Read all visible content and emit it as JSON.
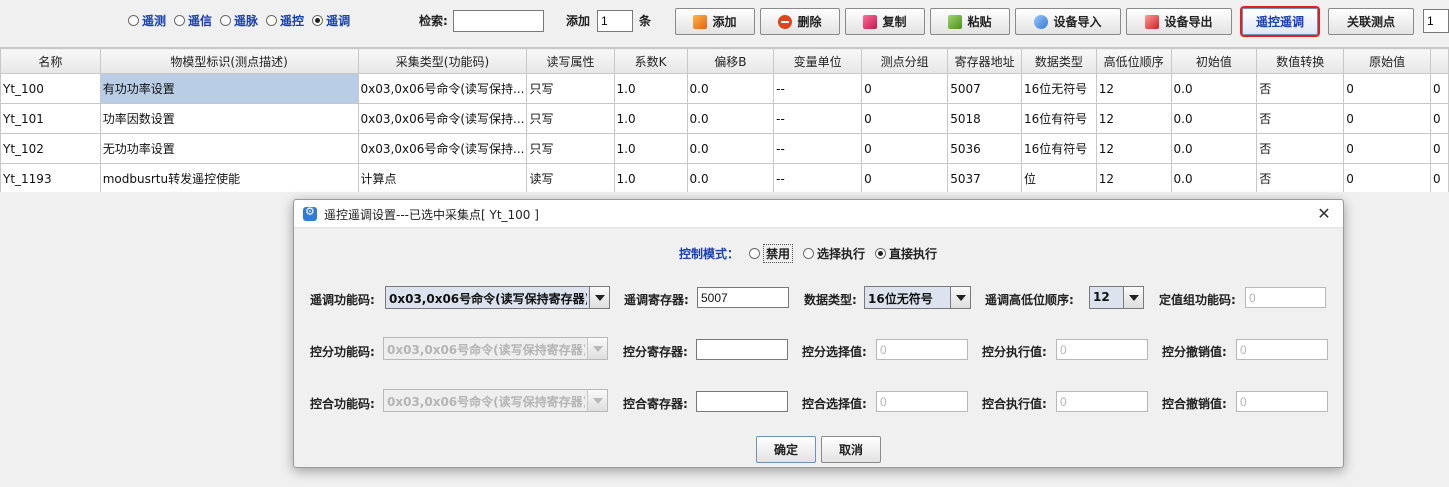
{
  "toolbar": {
    "radios": [
      {
        "label": "遥测",
        "selected": false
      },
      {
        "label": "遥信",
        "selected": false
      },
      {
        "label": "遥脉",
        "selected": false
      },
      {
        "label": "遥控",
        "selected": false
      },
      {
        "label": "遥调",
        "selected": true
      }
    ],
    "search_label": "检索:",
    "search_value": "",
    "add_label": "添加",
    "add_count": "1",
    "add_unit": "条",
    "buttons": {
      "add": "添加",
      "delete": "删除",
      "copy": "复制",
      "paste": "粘贴",
      "import": "设备导入",
      "export": "设备导出",
      "remote_control": "遥控遥调",
      "related_points": "关联测点"
    },
    "trailing_value": "1"
  },
  "table": {
    "columns": [
      "名称",
      "物模型标识(测点描述)",
      "采集类型(功能码)",
      "读写属性",
      "系数K",
      "偏移B",
      "变量单位",
      "测点分组",
      "寄存器地址",
      "数据类型",
      "高低位顺序",
      "初始值",
      "数值转换",
      "原始值",
      ""
    ],
    "rows": [
      {
        "cells": [
          "Yt_100",
          "有功功率设置",
          "0x03,0x06号命令(读写保持...",
          "只写",
          "1.0",
          "0.0",
          "--",
          "0",
          "5007",
          "16位无符号",
          "12",
          "0.0",
          "否",
          "0",
          "0"
        ],
        "selected": true
      },
      {
        "cells": [
          "Yt_101",
          "功率因数设置",
          "0x03,0x06号命令(读写保持...",
          "只写",
          "1.0",
          "0.0",
          "--",
          "0",
          "5018",
          "16位有符号",
          "12",
          "0.0",
          "否",
          "0",
          "0"
        ],
        "selected": false
      },
      {
        "cells": [
          "Yt_102",
          "无功功率设置",
          "0x03,0x06号命令(读写保持...",
          "只写",
          "1.0",
          "0.0",
          "--",
          "0",
          "5036",
          "16位有符号",
          "12",
          "0.0",
          "否",
          "0",
          "0"
        ],
        "selected": false
      },
      {
        "cells": [
          "Yt_1193",
          "modbusrtu转发遥控使能",
          "计算点",
          "读写",
          "1.0",
          "0.0",
          "--",
          "0",
          "5037",
          "位",
          "12",
          "0.0",
          "否",
          "0",
          "0"
        ],
        "selected": false
      }
    ]
  },
  "dialog": {
    "title": "遥控遥调设置---已选中采集点[ Yt_100 ]",
    "mode_label": "控制模式：",
    "modes": [
      {
        "label": "禁用",
        "selected": false
      },
      {
        "label": "选择执行",
        "selected": false
      },
      {
        "label": "直接执行",
        "selected": true
      }
    ],
    "row1": {
      "func_label": "遥调功能码:",
      "func_value": "0x03,0x06号命令(读写保持寄存器)",
      "reg_label": "遥调寄存器:",
      "reg_value": "5007",
      "dtype_label": "数据类型:",
      "dtype_value": "16位无符号",
      "order_label": "遥调高低位顺序:",
      "order_value": "12",
      "group_label": "定值组功能码:",
      "group_value": "0"
    },
    "row2": {
      "func_label": "控分功能码:",
      "func_value": "0x03,0x06号命令(读写保持寄存器)",
      "reg_label": "控分寄存器:",
      "reg_value": "",
      "sel_label": "控分选择值:",
      "sel_value": "0",
      "exec_label": "控分执行值:",
      "exec_value": "0",
      "cancel_label": "控分撤销值:",
      "cancel_value": "0"
    },
    "row3": {
      "func_label": "控合功能码:",
      "func_value": "0x03,0x06号命令(读写保持寄存器)",
      "reg_label": "控合寄存器:",
      "reg_value": "",
      "sel_label": "控合选择值:",
      "sel_value": "0",
      "exec_label": "控合执行值:",
      "exec_value": "0",
      "cancel_label": "控合撤销值:",
      "cancel_value": "0"
    },
    "ok_label": "确定",
    "cancel_label": "取消"
  }
}
